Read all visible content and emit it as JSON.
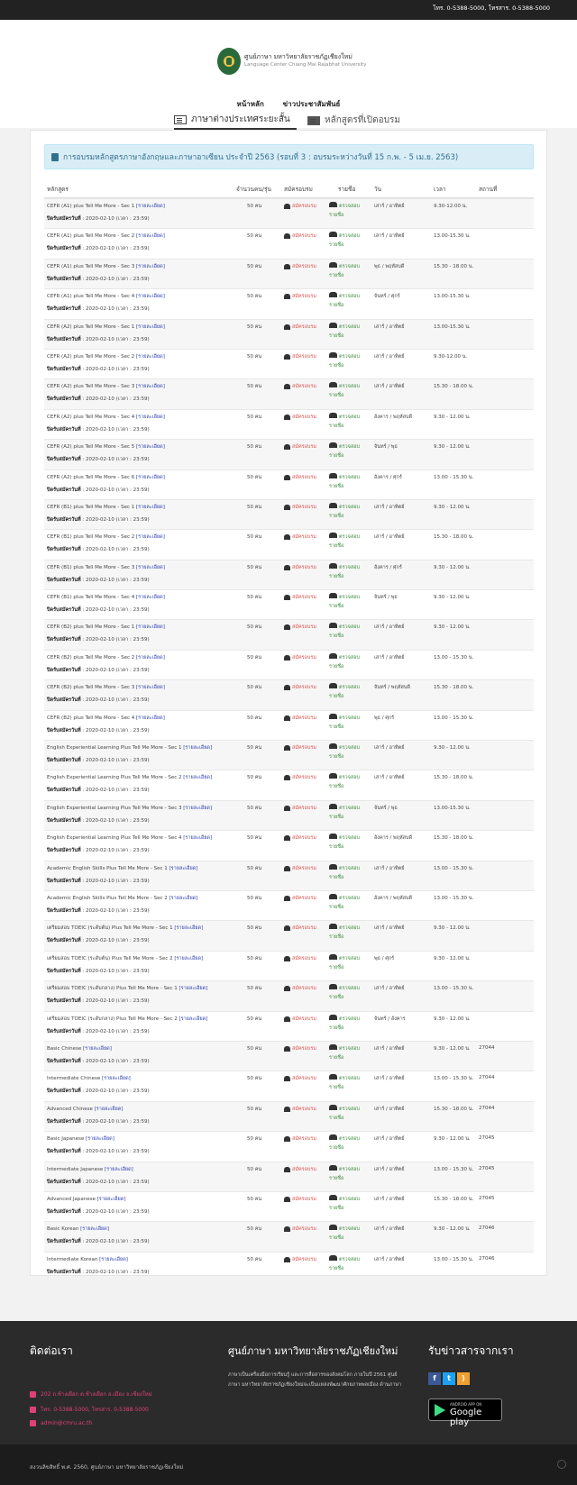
{
  "topbar": {
    "phone": "โทร. 0-5388-5000, โทรสาร. 0-5388-5000"
  },
  "header": {
    "org_th": "ศูนย์ภาษา มหาวิทยาลัยราชภัฏเชียงใหม่",
    "org_en": "Language Center Chiang Mai Rajabhat University"
  },
  "nav": {
    "home": "หน้าหลัก",
    "news": "ข่าวประชาสัมพันธ์"
  },
  "tabs": {
    "tab1": "ภาษาต่างประเทศระยะสั้น",
    "tab2": "หลักสูตรที่เปิดอบรม"
  },
  "alert": "การอบรมหลักสูตรภาษาอังกฤษและภาษาอาเซียน ประจำปี 2563 (รอบที่ 3 : อบรมระหว่างวันที่ 15 ก.พ. - 5 เม.ย. 2563)",
  "table": {
    "headers": {
      "course": "หลักสูตร",
      "seats": "จำนวนคน/รุ่น",
      "register": "สมัครอบรม",
      "list": "รายชื่อ",
      "day": "วัน",
      "time": "เวลา",
      "room": "สถานที่"
    },
    "detail_label": "[รายละเอียด]",
    "close_label": "ปิดรับสมัครวันที่",
    "close_value": " : 2020-02-10 (เวลา : 23:59)",
    "register_label": "สมัครอบรม",
    "check_label": "ตรวจสอบ",
    "list_label": "รายชื่อ",
    "rows": [
      {
        "name": "CEFR (A1) plus Tell Me More - Sec 1",
        "seats": "50 คน",
        "day": "เสาร์ / อาทิตย์",
        "time": "9.30-12.00 น.",
        "room": ""
      },
      {
        "name": "CEFR (A1) plus Tell Me More - Sec 2",
        "seats": "50 คน",
        "day": "เสาร์ / อาทิตย์",
        "time": "13.00-15.30 น.",
        "room": ""
      },
      {
        "name": "CEFR (A1) plus Tell Me More - Sec 3",
        "seats": "50 คน",
        "day": "พุธ / พฤหัสบดี",
        "time": "15.30 - 18.00 น.",
        "room": ""
      },
      {
        "name": "CEFR (A1) plus Tell Me More - Sec 4",
        "seats": "50 คน",
        "day": "จันทร์ / ศุกร์",
        "time": "13.00-15.30 น.",
        "room": ""
      },
      {
        "name": "CEFR (A2) plus Tell Me More - Sec 1",
        "seats": "50 คน",
        "day": "เสาร์ / อาทิตย์",
        "time": "13.00-15.30 น.",
        "room": ""
      },
      {
        "name": "CEFR (A2) plus Tell Me More - Sec 2",
        "seats": "50 คน",
        "day": "เสาร์ / อาทิตย์",
        "time": "9.30-12.00 น.",
        "room": ""
      },
      {
        "name": "CEFR (A2) plus Tell Me More - Sec 3",
        "seats": "50 คน",
        "day": "เสาร์ / อาทิตย์",
        "time": "15.30 - 18.00 น.",
        "room": ""
      },
      {
        "name": "CEFR (A2) plus Tell Me More - Sec 4",
        "seats": "50 คน",
        "day": "อังคาร / พฤหัสบดี",
        "time": "9.30 - 12.00 น.",
        "room": ""
      },
      {
        "name": "CEFR (A2) plus Tell Me More - Sec 5",
        "seats": "50 คน",
        "day": "จันทร์ / พุธ",
        "time": "9.30 - 12.00 น.",
        "room": ""
      },
      {
        "name": "CEFR (A2) plus Tell Me More - Sec 6",
        "seats": "50 คน",
        "day": "อังคาร / ศุกร์",
        "time": "13.00 - 15.30 น.",
        "room": ""
      },
      {
        "name": "CEFR (B1) plus Tell Me More - Sec 1",
        "seats": "50 คน",
        "day": "เสาร์ / อาทิตย์",
        "time": "9.30 - 12.00 น.",
        "room": ""
      },
      {
        "name": "CEFR (B1) plus Tell Me More - Sec 2",
        "seats": "50 คน",
        "day": "เสาร์ / อาทิตย์",
        "time": "15.30 - 18.00 น.",
        "room": ""
      },
      {
        "name": "CEFR (B1) plus Tell Me More - Sec 3",
        "seats": "50 คน",
        "day": "อังคาร / ศุกร์",
        "time": "9.30 - 12.00 น.",
        "room": ""
      },
      {
        "name": "CEFR (B1) plus Tell Me More - Sec 4",
        "seats": "50 คน",
        "day": "จันทร์ / พุธ",
        "time": "9.30 - 12.00 น.",
        "room": ""
      },
      {
        "name": "CEFR (B2) plus Tell Me More - Sec 1",
        "seats": "50 คน",
        "day": "เสาร์ / อาทิตย์",
        "time": "9.30 - 12.00 น.",
        "room": ""
      },
      {
        "name": "CEFR (B2) plus Tell Me More - Sec 2",
        "seats": "50 คน",
        "day": "เสาร์ / อาทิตย์",
        "time": "13.00 - 15.30 น.",
        "room": ""
      },
      {
        "name": "CEFR (B2) plus Tell Me More - Sec 3",
        "seats": "50 คน",
        "day": "จันทร์ / พฤหัสบดี",
        "time": "15.30 - 18.00 น.",
        "room": ""
      },
      {
        "name": "CEFR (B2) plus Tell Me More - Sec 4",
        "seats": "50 คน",
        "day": "พุธ / ศุกร์",
        "time": "13.00 - 15.30 น.",
        "room": ""
      },
      {
        "name": "English Experiential Learning Plus Tell Me More - Sec 1",
        "seats": "50 คน",
        "day": "เสาร์ / อาทิตย์",
        "time": "9.30 - 12.00 น.",
        "room": ""
      },
      {
        "name": "English Experiential Learning Plus Tell Me More - Sec 2",
        "seats": "50 คน",
        "day": "เสาร์ / อาทิตย์",
        "time": "15.30 - 18.00 น.",
        "room": ""
      },
      {
        "name": "English Experiential Learning Plus Tell Me More - Sec 3",
        "seats": "50 คน",
        "day": "จันทร์ / พุธ",
        "time": "13.00-15.30 น.",
        "room": ""
      },
      {
        "name": "English Experiential Learning Plus Tell Me More - Sec 4",
        "seats": "50 คน",
        "day": "อังคาร / พฤหัสบดี",
        "time": "15.30 - 18.00 น.",
        "room": ""
      },
      {
        "name": "Academic English Skills Plus Tell Me More - Sec 1",
        "seats": "50 คน",
        "day": "เสาร์ / อาทิตย์",
        "time": "13.00 - 15.30 น.",
        "room": ""
      },
      {
        "name": "Academic English Skills Plus Tell Me More - Sec 2",
        "seats": "50 คน",
        "day": "อังคาร / พฤหัสบดี",
        "time": "13.00 - 15.30 น.",
        "room": ""
      },
      {
        "name": "เตรียมสอบ TOEIC (ระดับต้น) Plus Tell Me More - Sec 1",
        "seats": "50 คน",
        "day": "เสาร์ / อาทิตย์",
        "time": "9.30 - 12.00 น.",
        "room": ""
      },
      {
        "name": "เตรียมสอบ TOEIC (ระดับต้น) Plus Tell Me More - Sec 2",
        "seats": "50 คน",
        "day": "พุธ / ศุกร์",
        "time": "9.30 - 12.00 น.",
        "room": ""
      },
      {
        "name": "เตรียมสอบ TOEIC (ระดับกลาง) Plus Tell Me More - Sec 1",
        "seats": "50 คน",
        "day": "เสาร์ / อาทิตย์",
        "time": "13.00 - 15.30 น.",
        "room": ""
      },
      {
        "name": "เตรียมสอบ TOEIC (ระดับกลาง) Plus Tell Me More - Sec 2",
        "seats": "50 คน",
        "day": "จันทร์ / อังคาร",
        "time": "9.30 - 12.00 น.",
        "room": ""
      },
      {
        "name": "Basic Chinese",
        "seats": "50 คน",
        "day": "เสาร์ / อาทิตย์",
        "time": "9.30 - 12.00 น.",
        "room": "27044"
      },
      {
        "name": "Intermediate Chinese",
        "seats": "50 คน",
        "day": "เสาร์ / อาทิตย์",
        "time": "13.00 - 15.30 น.",
        "room": "27044"
      },
      {
        "name": "Advanced Chinese",
        "seats": "50 คน",
        "day": "เสาร์ / อาทิตย์",
        "time": "15.30 - 18.00 น.",
        "room": "27044"
      },
      {
        "name": "Basic Japanese",
        "seats": "50 คน",
        "day": "เสาร์ / อาทิตย์",
        "time": "9.30 - 12.00 น.",
        "room": "27045"
      },
      {
        "name": "Intermediate Japanese",
        "seats": "50 คน",
        "day": "เสาร์ / อาทิตย์",
        "time": "13.00 - 15.30 น.",
        "room": "27045"
      },
      {
        "name": "Advanced Japanese",
        "seats": "50 คน",
        "day": "เสาร์ / อาทิตย์",
        "time": "15.30 - 18.00 น.",
        "room": "27045"
      },
      {
        "name": "Basic Korean",
        "seats": "50 คน",
        "day": "เสาร์ / อาทิตย์",
        "time": "9.30 - 12.00 น.",
        "room": "27046"
      },
      {
        "name": "Intermediate Korean",
        "seats": "50 คน",
        "day": "เสาร์ / อาทิตย์",
        "time": "13.00 - 15.30 น.",
        "room": "27046"
      }
    ]
  },
  "footer": {
    "contact_title": "ติดต่อเรา",
    "center_title": "ศูนย์ภาษา มหาวิทยาลัยราชภัฏเชียงใหม่",
    "news_title": "รับข่าวสารจากเรา",
    "about": "ภาษาเป็นเครื่องมือการเรียนรู้ และการสื่อสารของสังคมโลก ภายในปี 2561 ศูนย์ภาษา มหาวิทยาลัยราชภัฏเชียงใหม่จะเป็นแหล่งพัฒนาศักยภาพพลเมือง ด้านภาษา",
    "address": "202 ถ.ช้างเผือก ต.ช้างเผือก อ.เมือง จ.เชียงใหม่",
    "phone": "โทร. 0-5388-5000, โทรสาร. 0-5388-5000",
    "email": "admin@cmru.ac.th",
    "gplay_small": "ANDROID APP ON",
    "gplay_big": "Google play",
    "copyright": "สงวนลิขสิทธิ์ พ.ศ. 2560, ศูนย์ภาษา มหาวิทยาลัยราชภัฏเชียงใหม่",
    "colors": {
      "facebook": "#3b5998",
      "twitter": "#1da1f2",
      "rss": "#f0a030"
    }
  }
}
